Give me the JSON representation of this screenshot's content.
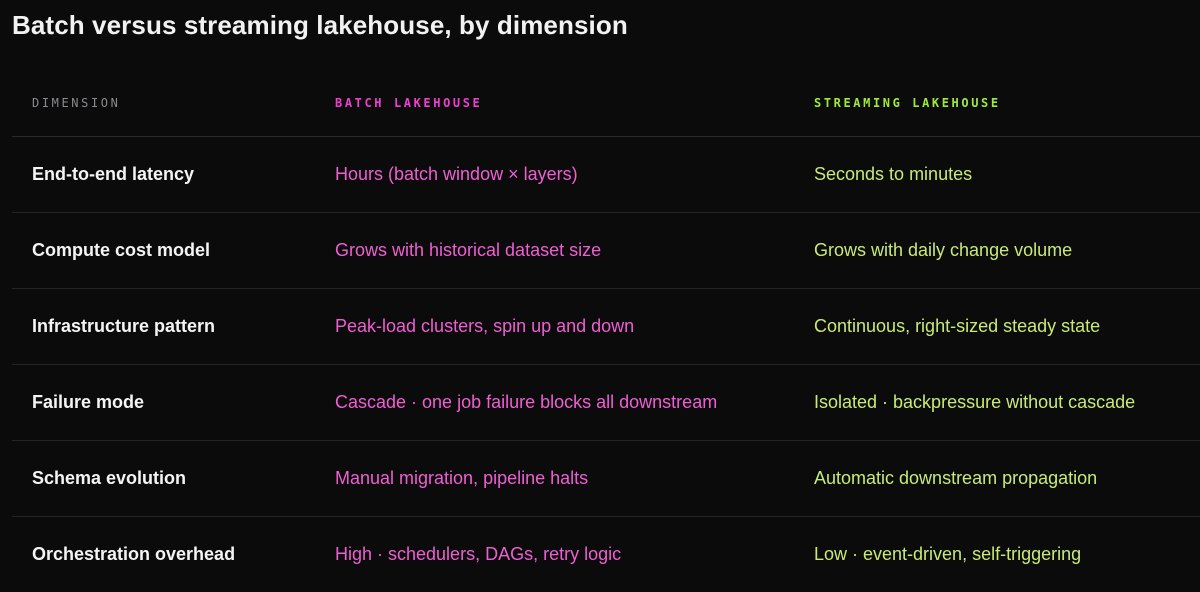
{
  "title": "Batch versus streaming lakehouse, by dimension",
  "colors": {
    "background": "#0b0b0c",
    "batch_accent": "#ee3fcf",
    "streaming_accent": "#9dea3a"
  },
  "table": {
    "headers": {
      "dimension": "DIMENSION",
      "batch": "BATCH LAKEHOUSE",
      "streaming": "STREAMING LAKEHOUSE"
    },
    "rows": [
      {
        "dimension": "End-to-end latency",
        "batch": "Hours (batch window × layers)",
        "streaming": "Seconds to minutes"
      },
      {
        "dimension": "Compute cost model",
        "batch": "Grows with historical dataset size",
        "streaming": "Grows with daily change volume"
      },
      {
        "dimension": "Infrastructure pattern",
        "batch": "Peak-load clusters, spin up and down",
        "streaming": "Continuous, right-sized steady state"
      },
      {
        "dimension": "Failure mode",
        "batch": "Cascade · one job failure blocks all downstream",
        "streaming": "Isolated · backpressure without cascade"
      },
      {
        "dimension": "Schema evolution",
        "batch": "Manual migration, pipeline halts",
        "streaming": "Automatic downstream propagation"
      },
      {
        "dimension": "Orchestration overhead",
        "batch": "High · schedulers, DAGs, retry logic",
        "streaming": "Low · event-driven, self-triggering"
      }
    ]
  }
}
